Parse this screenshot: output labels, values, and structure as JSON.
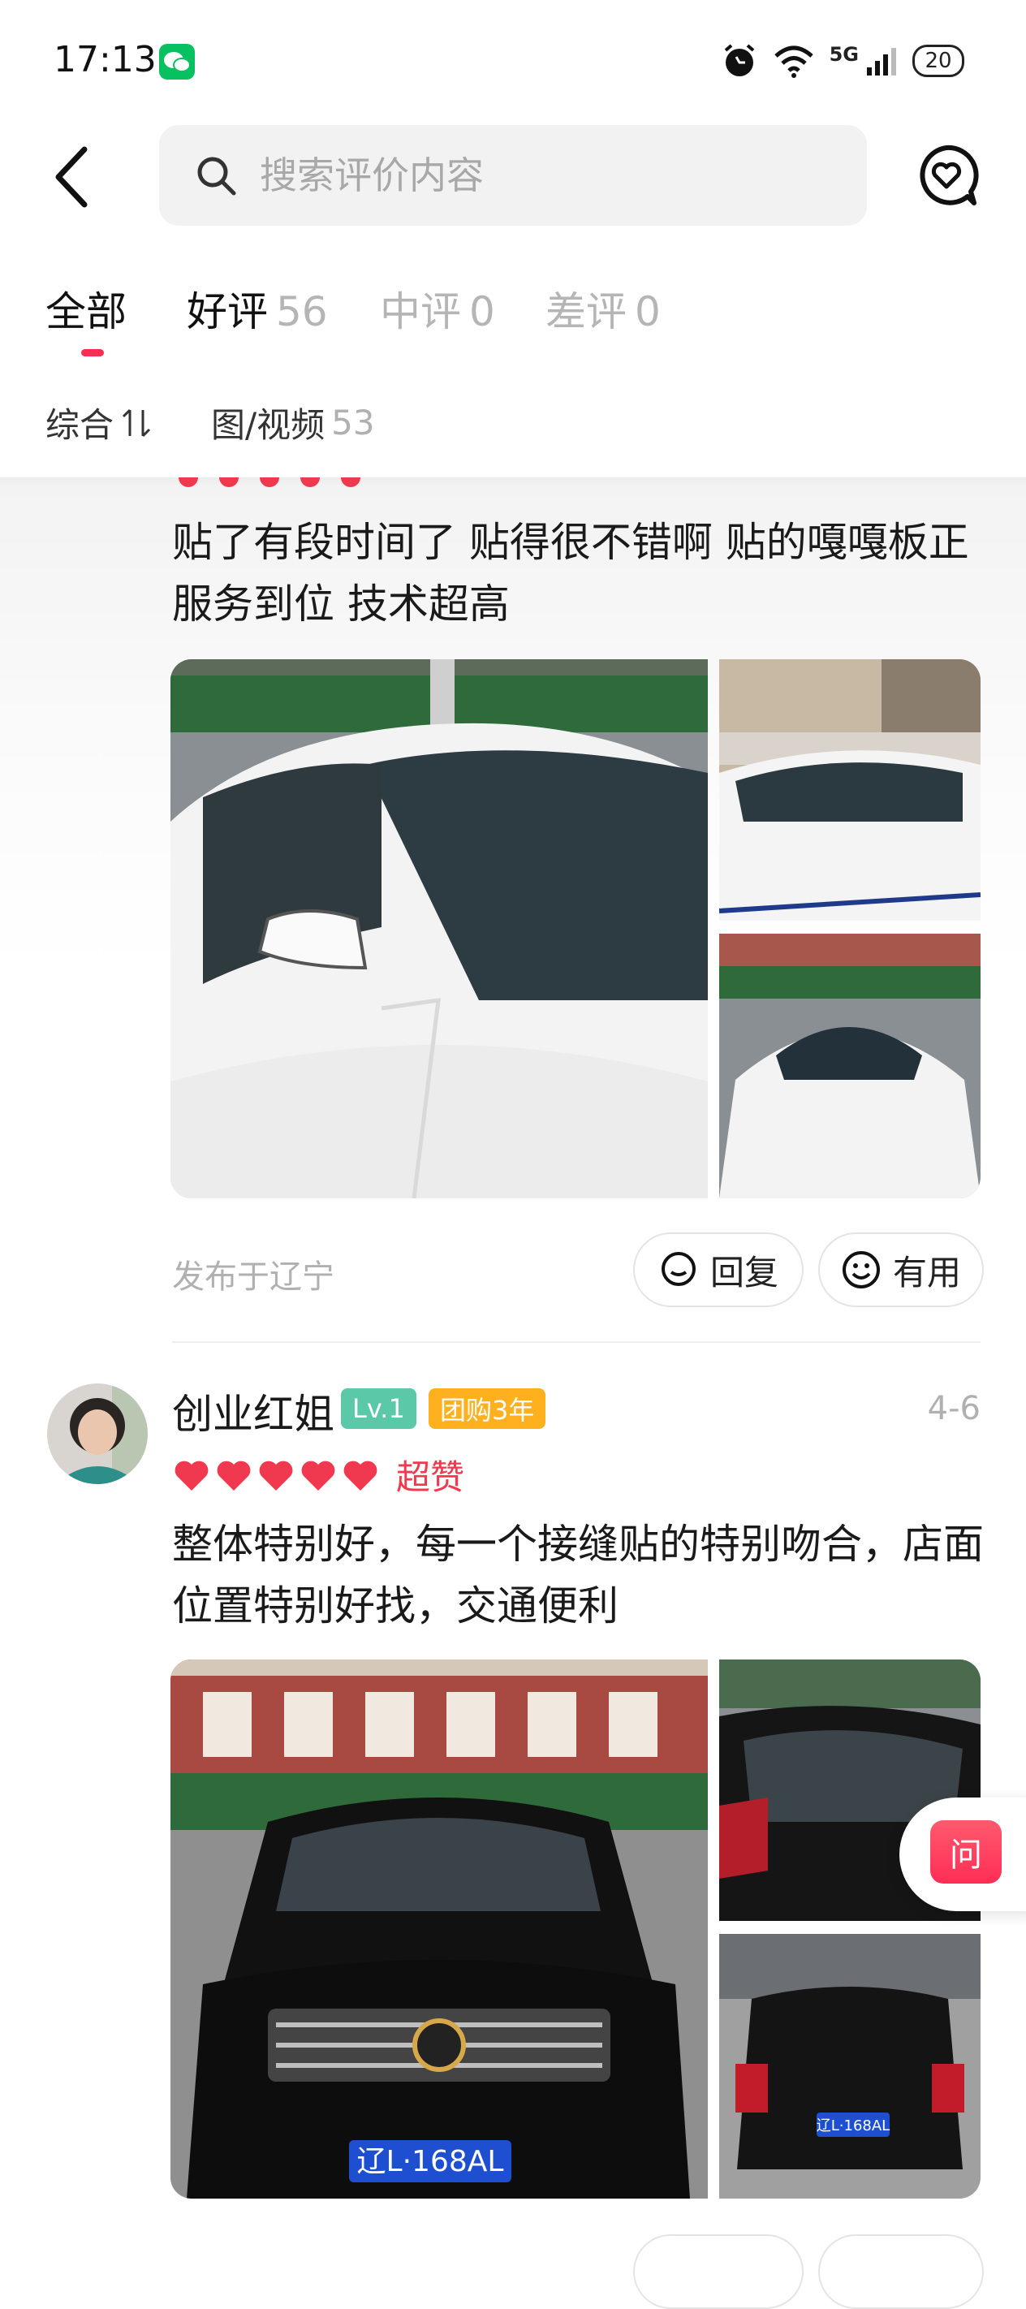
{
  "status_bar": {
    "time": "17:13",
    "network": "5G",
    "battery": "20",
    "icons": [
      "wechat-icon",
      "alarm-icon",
      "wifi-icon",
      "signal-icon",
      "battery-icon"
    ]
  },
  "header": {
    "search_placeholder": "搜索评价内容"
  },
  "tabs": [
    {
      "label": "全部",
      "count": ""
    },
    {
      "label": "好评",
      "count": "56"
    },
    {
      "label": "中评",
      "count": "0"
    },
    {
      "label": "差评",
      "count": "0"
    }
  ],
  "sub_tabs": [
    {
      "label": "综合",
      "icon": "sort-icon"
    },
    {
      "label": "图/视频",
      "count": "53"
    }
  ],
  "reviews": [
    {
      "text": "贴了有段时间了 贴得很不错啊 贴的嘎嘎板正 服务到位 技术超高",
      "location": "发布于辽宁",
      "reply_label": "回复",
      "useful_label": "有用"
    },
    {
      "username": "创业红姐",
      "level": "Lv.1",
      "tenure": "团购3年",
      "date": "4-6",
      "rating_label": "超赞",
      "rating": 5,
      "text": "整体特别好，每一个接缝贴的特别吻合，店面位置特别好找，交通便利",
      "plates": [
        "辽L·168AL",
        "辽L·168AL"
      ]
    }
  ],
  "float_button": {
    "label": "问"
  },
  "colors": {
    "accent": "#ff2d55",
    "heart": "#f0394f",
    "level_badge": "#5bc8a8",
    "tenure_badge": "#ffb01f"
  }
}
